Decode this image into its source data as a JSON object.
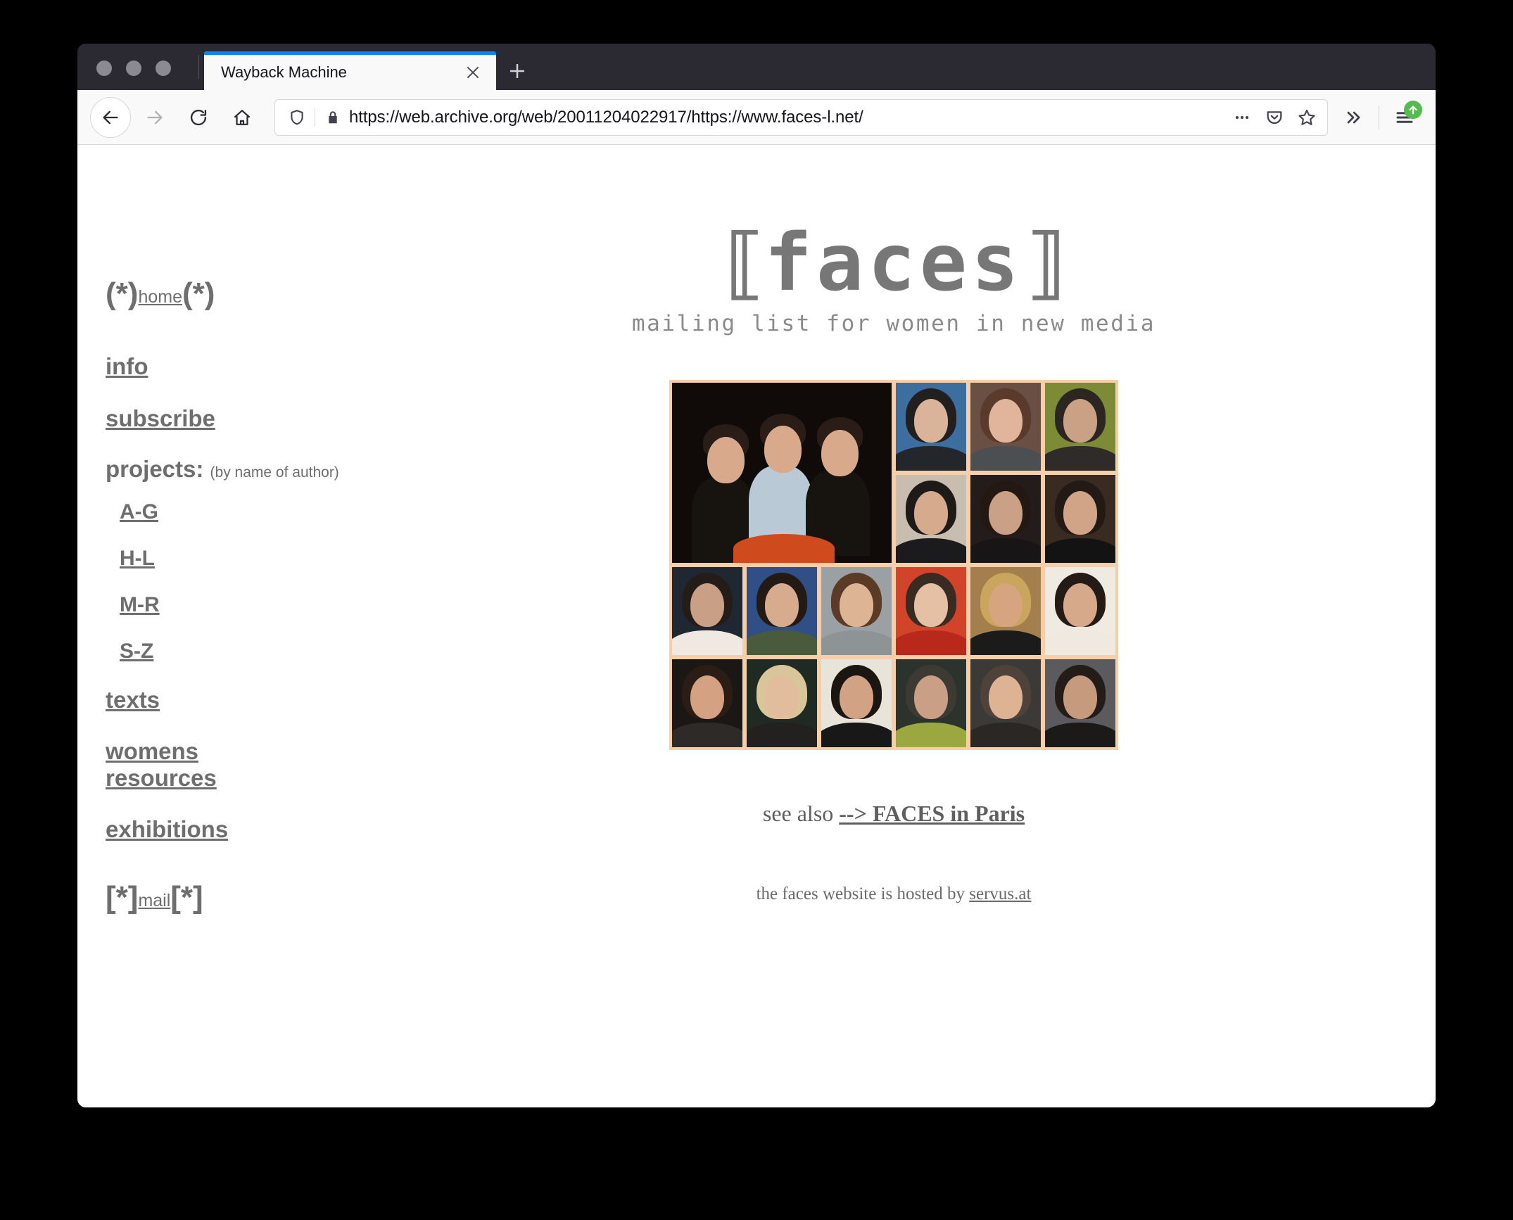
{
  "browser": {
    "window_controls": [
      "close",
      "minimize",
      "maximize"
    ],
    "tab": {
      "title": "Wayback Machine",
      "close_label": "×"
    },
    "new_tab_label": "+",
    "toolbar": {
      "back_label": "Back",
      "forward_label": "Forward",
      "reload_label": "Reload",
      "home_label": "Home",
      "tracking_protection_label": "Tracking protection",
      "lock_label": "Secure connection",
      "url": "https://web.archive.org/web/20011204022917/https://www.faces-l.net/",
      "page_actions_label": "…",
      "pocket_label": "Save to Pocket",
      "bookmark_label": "Bookmark this page",
      "overflow_label": "»",
      "menu_label": "Open application menu",
      "update_badge_label": "Update available"
    },
    "colors": {
      "chrome": "#2b2a33",
      "toolbar": "#f9f9fa",
      "active_tab_accent": "#0a84ff",
      "update_badge": "#54bb4e"
    }
  },
  "page": {
    "sidebar": {
      "home": {
        "left_deco": "(*)",
        "label": "home",
        "right_deco": "(*)"
      },
      "items": [
        {
          "label": "info"
        },
        {
          "label": "subscribe"
        }
      ],
      "projects": {
        "heading": "projects:",
        "note": "(by name of author)",
        "sub_items": [
          {
            "label": "A-G"
          },
          {
            "label": "H-L"
          },
          {
            "label": "M-R"
          },
          {
            "label": "S-Z"
          }
        ]
      },
      "items_after": [
        {
          "label": "texts",
          "lines": [
            "texts"
          ]
        },
        {
          "label": "womens resources",
          "lines": [
            "womens",
            "resources"
          ]
        },
        {
          "label": "exhibitions",
          "lines": [
            "exhibitions"
          ]
        }
      ],
      "mail": {
        "left_deco": "[*]",
        "label": "mail",
        "right_deco": "[*]"
      }
    },
    "logo": {
      "open_bracket": "⟦",
      "word": "faces",
      "close_bracket": "⟧",
      "tagline": "mailing list for women in new media",
      "color": "#777777"
    },
    "collage": {
      "alt": "photo collage of faces participants",
      "background": "#f6ceaa",
      "columns": 6,
      "rows": 4,
      "tiles": [
        {
          "type": "group-photo",
          "span_cols": 3,
          "span_rows": 2,
          "bg": "#100b09",
          "skin": "#d8a98b",
          "hair": "#2a1d17",
          "cloth": "#b9cad6"
        },
        {
          "type": "portrait",
          "bg": "#3c6ea0",
          "skin": "#d9b49a",
          "hair": "#22201f",
          "cloth": "#23262b"
        },
        {
          "type": "portrait",
          "bg": "#6a4f45",
          "skin": "#e0b59c",
          "hair": "#5a3a2a",
          "cloth": "#4b4f52"
        },
        {
          "type": "portrait",
          "bg": "#7d8a36",
          "skin": "#caa184",
          "hair": "#2c2622",
          "cloth": "#2f2b28"
        },
        {
          "type": "portrait",
          "bg": "#c9bdb0",
          "skin": "#d6ab8d",
          "hair": "#1d1a18",
          "cloth": "#1b1b1d"
        },
        {
          "type": "portrait",
          "bg": "#241c1a",
          "skin": "#caa087",
          "hair": "#241813",
          "cloth": "#171515"
        },
        {
          "type": "portrait",
          "bg": "#3a2b22",
          "skin": "#d1a387",
          "hair": "#231a16",
          "cloth": "#141313"
        },
        {
          "type": "portrait",
          "bg": "#1f2733",
          "skin": "#c99f86",
          "hair": "#241c18",
          "cloth": "#efe9e2"
        },
        {
          "type": "portrait",
          "bg": "#2f4f86",
          "skin": "#d7ab8e",
          "hair": "#241a15",
          "cloth": "#4a5a3c"
        },
        {
          "type": "portrait",
          "bg": "#9aa0a4",
          "skin": "#ddb595",
          "hair": "#5b3b25",
          "cloth": "#8e9396"
        },
        {
          "type": "portrait",
          "bg": "#d2442a",
          "skin": "#e6c0a5",
          "hair": "#3a2b22",
          "cloth": "#b8291c"
        },
        {
          "type": "portrait",
          "bg": "#a47f4e",
          "skin": "#d7a480",
          "hair": "#c9a55e",
          "cloth": "#1c1b1b"
        },
        {
          "type": "portrait",
          "bg": "#efeae2",
          "skin": "#d7a98b",
          "hair": "#241b16",
          "cloth": "#efe9df"
        },
        {
          "type": "portrait",
          "bg": "#1b1714",
          "skin": "#d5a183",
          "hair": "#2b1d16",
          "cloth": "#2e2a28"
        },
        {
          "type": "portrait",
          "bg": "#1e2a22",
          "skin": "#e2bd9d",
          "hair": "#d8c59a",
          "cloth": "#23211f"
        },
        {
          "type": "portrait",
          "bg": "#e9e4da",
          "skin": "#d2a285",
          "hair": "#1c1612",
          "cloth": "#191818"
        },
        {
          "type": "portrait",
          "bg": "#2b332c",
          "skin": "#c9a086",
          "hair": "#3d3a34",
          "cloth": "#9aa83f"
        },
        {
          "type": "portrait",
          "bg": "#3c3a37",
          "skin": "#ddb393",
          "hair": "#4e423a",
          "cloth": "#2a2724"
        },
        {
          "type": "portrait",
          "bg": "#5a5a5f",
          "skin": "#c69a7d",
          "hair": "#241c18",
          "cloth": "#1b1a19"
        }
      ]
    },
    "see_also": {
      "prefix": "see also ",
      "link": "--> FACES in Paris"
    },
    "hosted": {
      "prefix": "the faces website is hosted by ",
      "link": "servus.at"
    }
  }
}
